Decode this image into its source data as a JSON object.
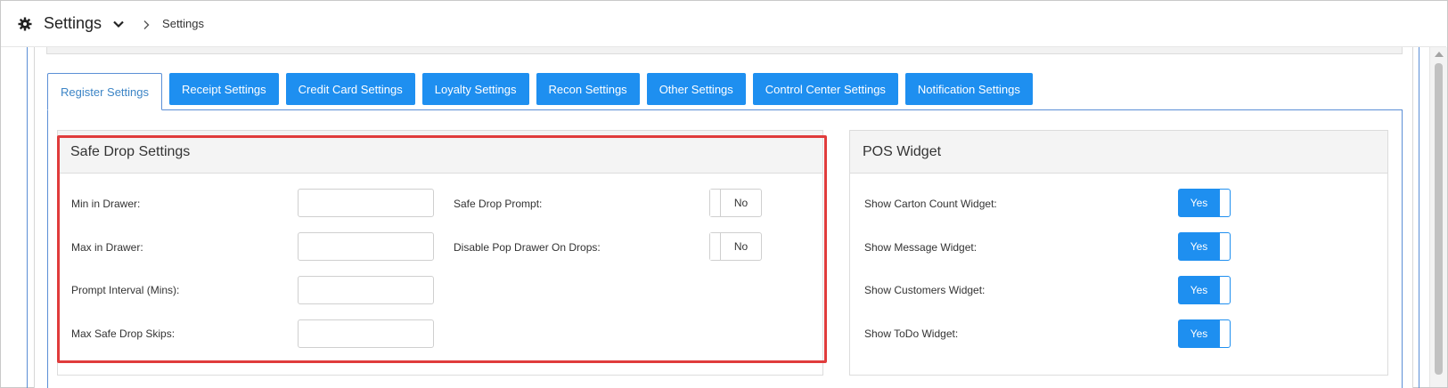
{
  "header": {
    "title": "Settings",
    "breadcrumb": "Settings"
  },
  "tabs": [
    {
      "label": "Register Settings",
      "active": true
    },
    {
      "label": "Receipt Settings",
      "active": false
    },
    {
      "label": "Credit Card Settings",
      "active": false
    },
    {
      "label": "Loyalty Settings",
      "active": false
    },
    {
      "label": "Recon Settings",
      "active": false
    },
    {
      "label": "Other Settings",
      "active": false
    },
    {
      "label": "Control Center Settings",
      "active": false
    },
    {
      "label": "Notification Settings",
      "active": false
    }
  ],
  "safe_drop": {
    "title": "Safe Drop Settings",
    "fields": [
      {
        "label": "Min in Drawer:",
        "value": ""
      },
      {
        "label": "Max in Drawer:",
        "value": ""
      },
      {
        "label": "Prompt Interval (Mins):",
        "value": ""
      },
      {
        "label": "Max Safe Drop Skips:",
        "value": ""
      }
    ],
    "toggles": [
      {
        "label": "Safe Drop Prompt:",
        "state": "No"
      },
      {
        "label": "Disable Pop Drawer On Drops:",
        "state": "No"
      }
    ]
  },
  "pos_widget": {
    "title": "POS Widget",
    "toggles": [
      {
        "label": "Show Carton Count Widget:",
        "state": "Yes"
      },
      {
        "label": "Show Message Widget:",
        "state": "Yes"
      },
      {
        "label": "Show Customers Widget:",
        "state": "Yes"
      },
      {
        "label": "Show ToDo Widget:",
        "state": "Yes"
      }
    ]
  },
  "colors": {
    "accent": "#1e8ff0",
    "highlight": "#e03c3c",
    "tab_border": "#5b8fd6"
  },
  "icons": {
    "header": "gear-icon",
    "dropdown": "chevron-down-icon",
    "breadcrumb_sep": "chevron-right-icon"
  }
}
